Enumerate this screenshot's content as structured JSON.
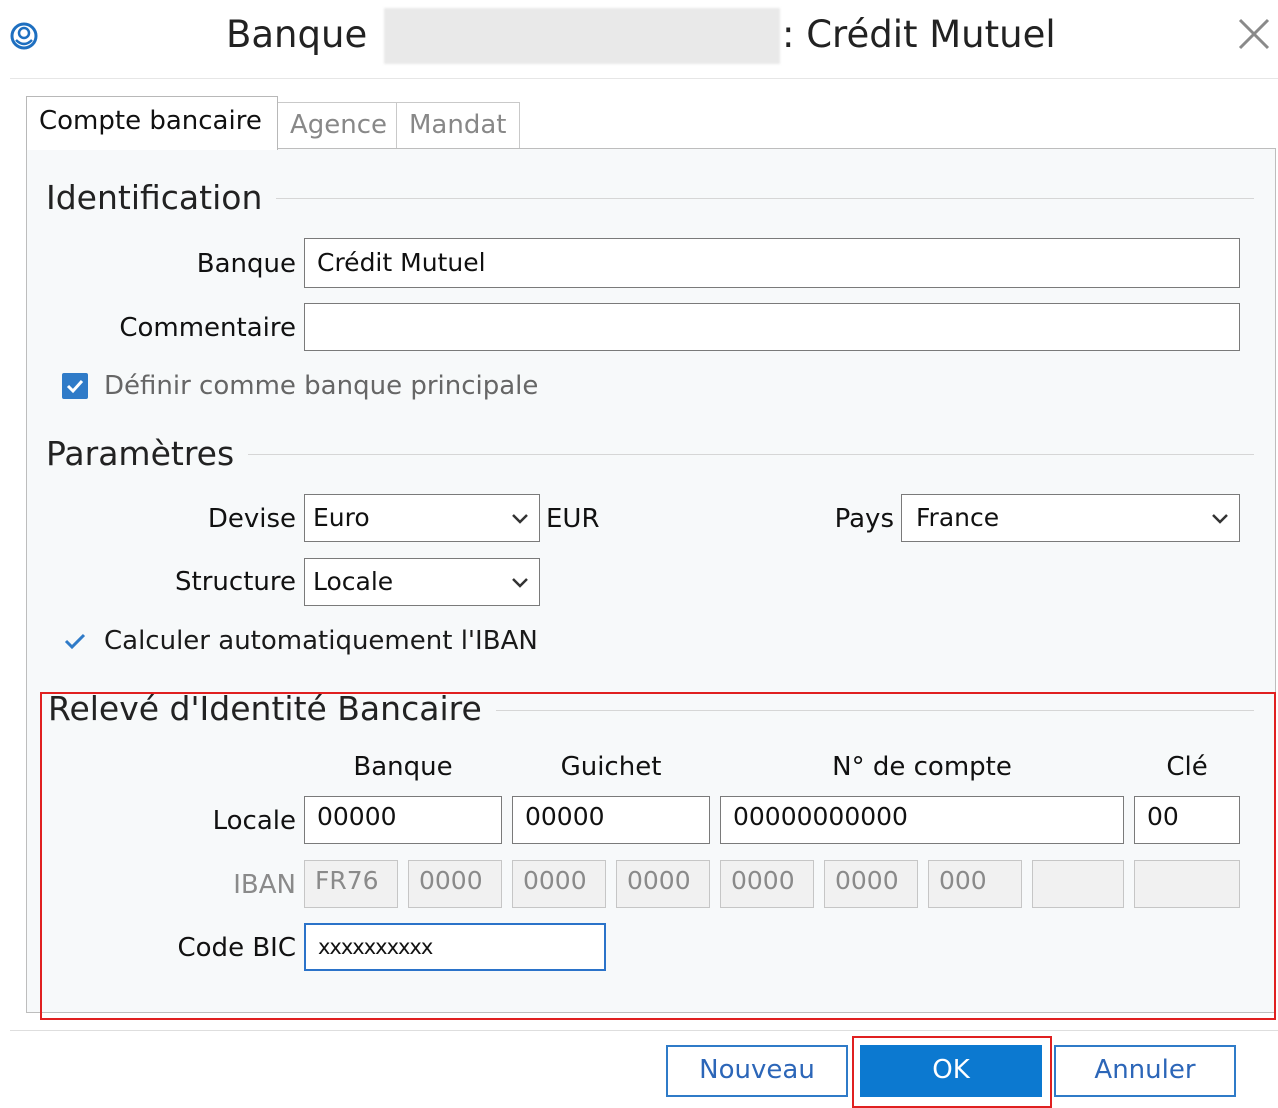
{
  "window": {
    "title_prefix": "Banque",
    "title_suffix": ": Crédit Mutuel",
    "icons": {
      "app": "app-logo-icon",
      "close": "close-icon"
    }
  },
  "tabs": [
    {
      "label": "Compte bancaire",
      "active": true
    },
    {
      "label": "Agence",
      "active": false
    },
    {
      "label": "Mandat",
      "active": false
    }
  ],
  "identification": {
    "title": "Identification",
    "banque_label": "Banque",
    "banque_value": "Crédit Mutuel",
    "commentaire_label": "Commentaire",
    "commentaire_value": "",
    "principal_label": "Définir comme banque principale",
    "principal_checked": true
  },
  "parametres": {
    "title": "Paramètres",
    "devise_label": "Devise",
    "devise_value": "Euro",
    "devise_code": "EUR",
    "pays_label": "Pays",
    "pays_value": "France",
    "structure_label": "Structure",
    "structure_value": "Locale",
    "iban_auto_label": "Calculer automatiquement l'IBAN",
    "iban_auto_checked": true
  },
  "rib": {
    "title": "Relevé d'Identité Bancaire",
    "col_banque": "Banque",
    "col_guichet": "Guichet",
    "col_compte": "N° de compte",
    "col_cle": "Clé",
    "locale_label": "Locale",
    "locale_banque": "00000",
    "locale_guichet": "00000",
    "locale_compte": "00000000000",
    "locale_cle": "00",
    "iban_label": "IBAN",
    "iban": [
      "FR76",
      "0000",
      "0000",
      "0000",
      "0000",
      "0000",
      "000",
      "",
      ""
    ],
    "bic_label": "Code BIC",
    "bic_value": "xxxxxxxxxx"
  },
  "footer": {
    "nouveau": "Nouveau",
    "ok": "OK",
    "annuler": "Annuler"
  },
  "colors": {
    "accent": "#0c79d0",
    "highlight": "#e02020"
  }
}
